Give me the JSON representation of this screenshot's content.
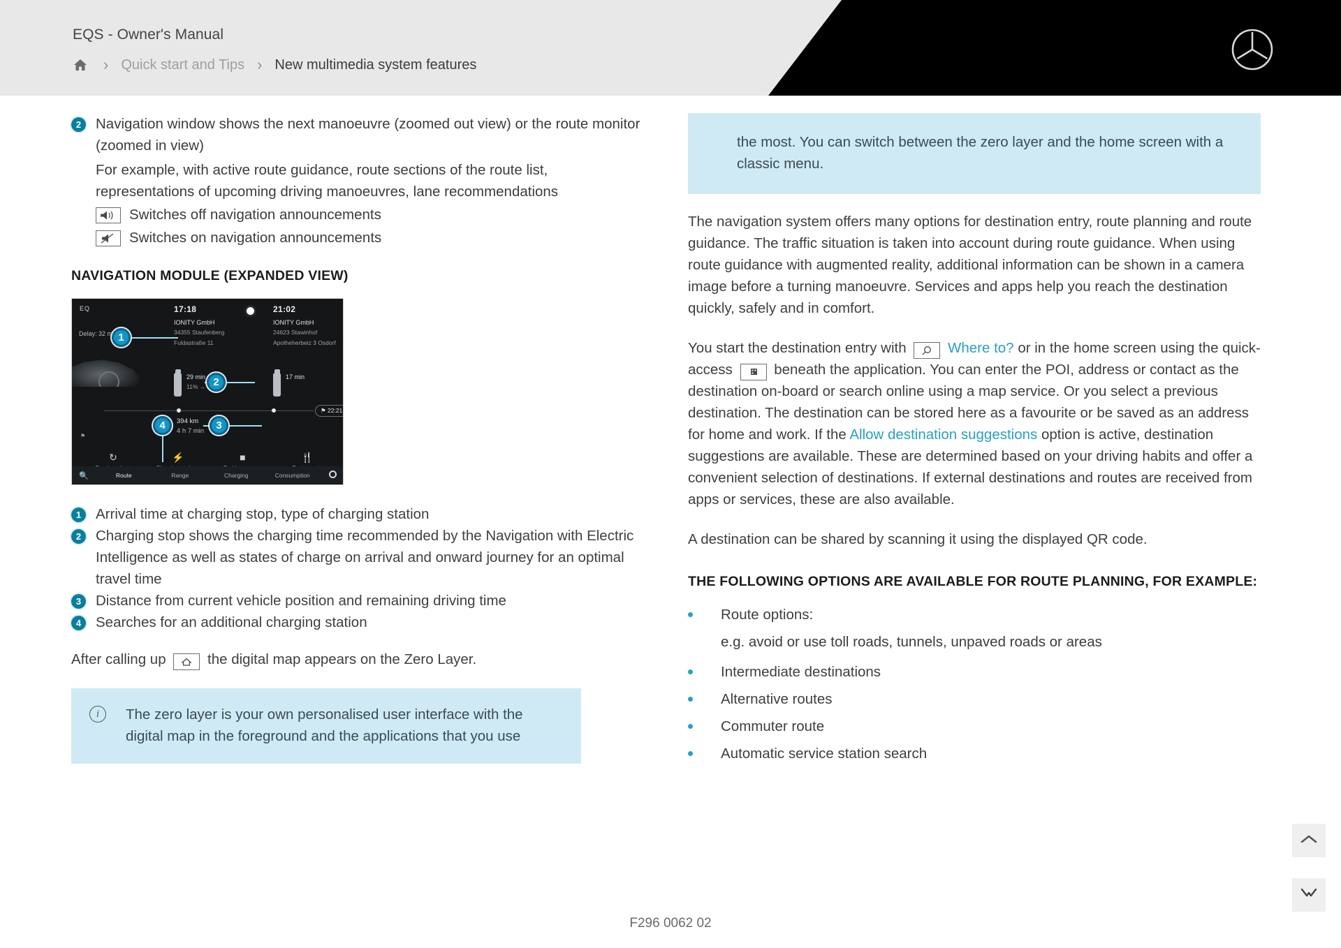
{
  "header": {
    "manual_title": "EQS - Owner's Manual",
    "breadcrumb": {
      "home_icon": "home-icon",
      "separator": "›",
      "level1": "Quick start and Tips",
      "level2": "New multimedia system features"
    },
    "brand_logo": "mercedes-benz-star-icon"
  },
  "left": {
    "item2": {
      "number": "2",
      "text": "Navigation window shows the next manoeuvre (zoomed out view) or the route monitor (zoomed in view)",
      "sub": "For example, with active route guidance, route sections of the route list, representations of upcoming driving manoeuvres, lane recommendations",
      "icon_rows": [
        {
          "icon": "speaker-on-icon",
          "label": "Switches off navigation announcements"
        },
        {
          "icon": "speaker-muted-icon",
          "label": "Switches on navigation announcements"
        }
      ]
    },
    "section_heading": "NAVIGATION MODULE (EXPANDED VIEW)",
    "screenshot": {
      "eq_label": "EQ",
      "delay": "Delay: 32 min",
      "stop1": {
        "time": "17:18",
        "name": "IONITY GmbH",
        "addr_line1": "34355 Staufenberg",
        "addr_line2": "Fuldastraße 11",
        "charge_time": "29 min",
        "charge_levels": "11% → 82%"
      },
      "stop2": {
        "time": "21:02",
        "name": "IONITY GmbH",
        "addr_line1": "24623 Stawinhof",
        "addr_line2": "Apotheherbeiz 3 Osdorf",
        "charge_time": "17 min"
      },
      "eta_badge": "22:21",
      "total_distance": "394 km",
      "total_duration": "4 h 7 min",
      "quick_actions": [
        {
          "icon": "history-icon",
          "label": "Previous dest."
        },
        {
          "icon": "charging-station-icon",
          "label": "Charging stations"
        },
        {
          "icon": "parking-icon",
          "label": "Parking spaces"
        },
        {
          "icon": "restaurant-icon",
          "label": "Restaurants"
        }
      ],
      "tabs": [
        "Route",
        "Range",
        "Charging",
        "Consumption"
      ],
      "active_tab": "Route",
      "search_icon": "search-icon",
      "menu_icon": "circle-icon",
      "callouts": [
        "1",
        "2",
        "3",
        "4"
      ]
    },
    "legend": [
      {
        "number": "1",
        "text": "Arrival time at charging stop, type of charging station"
      },
      {
        "number": "2",
        "text": "Charging stop shows the charging time recommended by the Navigation with Electric Intelligence as well as states of charge on arrival and onward journey for an optimal travel time"
      },
      {
        "number": "3",
        "text": "Distance from current vehicle position and remaining driving time"
      },
      {
        "number": "4",
        "text": "Searches for an additional charging station"
      }
    ],
    "after_calling": {
      "before": "After calling up",
      "icon": "home-map-icon",
      "after": "the digital map appears on the Zero Layer."
    },
    "info_box": {
      "icon": "info-icon",
      "text": "The zero layer is your own personalised user interface with the digital map in the foreground and the applications that you use"
    }
  },
  "right": {
    "info_box_top": {
      "text": "the most. You can switch between the zero layer and the home screen with a classic menu."
    },
    "para1": "The navigation system offers many options for destination entry, route planning and route guidance. The traffic situation is taken into account during route guidance. When using route guidance with augmented reality, additional information can be shown in a camera image before a turning manoeuvre. Services and apps help you reach the destination quickly, safely and in comfort.",
    "para2": {
      "p1": "You start the destination entry with",
      "search_icon": "magnifier-icon",
      "link1": "Where to?",
      "p2": "or in the home screen using the quick-access",
      "quick_icon": "quick-access-icon",
      "p3": "beneath the application. You can enter the POI, address or contact as the destination on-board or search online using a map service. Or you select a previous destination. The destination can be stored here as a favourite or be saved as an address for home and work. If the",
      "link2": "Allow destination suggestions",
      "p4": "option is active, destination suggestions are available. These are determined based on your driving habits and offer a convenient selection of destinations. If external destinations and routes are received from apps or services, these are also available."
    },
    "para3": "A destination can be shared by scanning it using the displayed QR code.",
    "section_heading": "THE FOLLOWING OPTIONS ARE AVAILABLE FOR ROUTE PLANNING, FOR EXAMPLE:",
    "bullets": [
      {
        "text": "Route options:",
        "sub": "e.g. avoid or use toll roads, tunnels, unpaved roads or areas"
      },
      {
        "text": "Intermediate destinations"
      },
      {
        "text": "Alternative routes"
      },
      {
        "text": "Commuter route"
      },
      {
        "text": "Automatic service station search"
      }
    ]
  },
  "controls": {
    "scroll_top_icon": "chevron-up-icon",
    "collapse_icon": "chevron-collapse-icon"
  },
  "footer": {
    "doc_id": "F296 0062 02"
  },
  "colors": {
    "accent": "#2a9fc4",
    "badge": "#0a7e9c",
    "info_bg": "#cfeaf5",
    "header_bg": "#e8e8e8"
  }
}
